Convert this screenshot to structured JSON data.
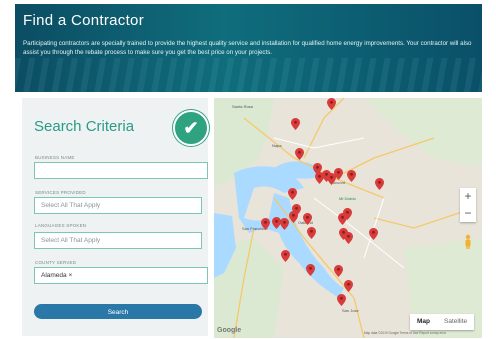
{
  "banner": {
    "title": "Find a Contractor",
    "description": "Participating contractors are specially trained to provide the highest quality service and installation for qualified home energy improvements. Your contractor will also assist you through the rebate process to make sure you get the best price on your projects."
  },
  "search": {
    "title": "Search Criteria",
    "business_name_label": "BUSINESS NAME",
    "business_name_value": "",
    "services_label": "SERVICES PROVIDED",
    "services_placeholder": "Select All That Apply",
    "languages_label": "LANGUAGES SPOKEN",
    "languages_placeholder": "Select All That Apply",
    "county_label": "COUNTY SERVED",
    "county_value": "Alameda ×",
    "search_button": "Search"
  },
  "map": {
    "zoom_in": "+",
    "zoom_out": "−",
    "map_tab": "Map",
    "satellite_tab": "Satellite",
    "logo": "Google",
    "attribution": "Map data ©2019 Google   Terms of Use   Report a map error",
    "cities": [
      "Santa Rosa",
      "Napa",
      "San Francisco",
      "Oakland",
      "Mt Diablo",
      "San Jose",
      "Concord"
    ],
    "pin_color": "#d93a3a",
    "pin_count": 28
  },
  "colors": {
    "accent": "#2a9a88",
    "button": "#2a78a8",
    "banner": "#0f6d7c"
  }
}
